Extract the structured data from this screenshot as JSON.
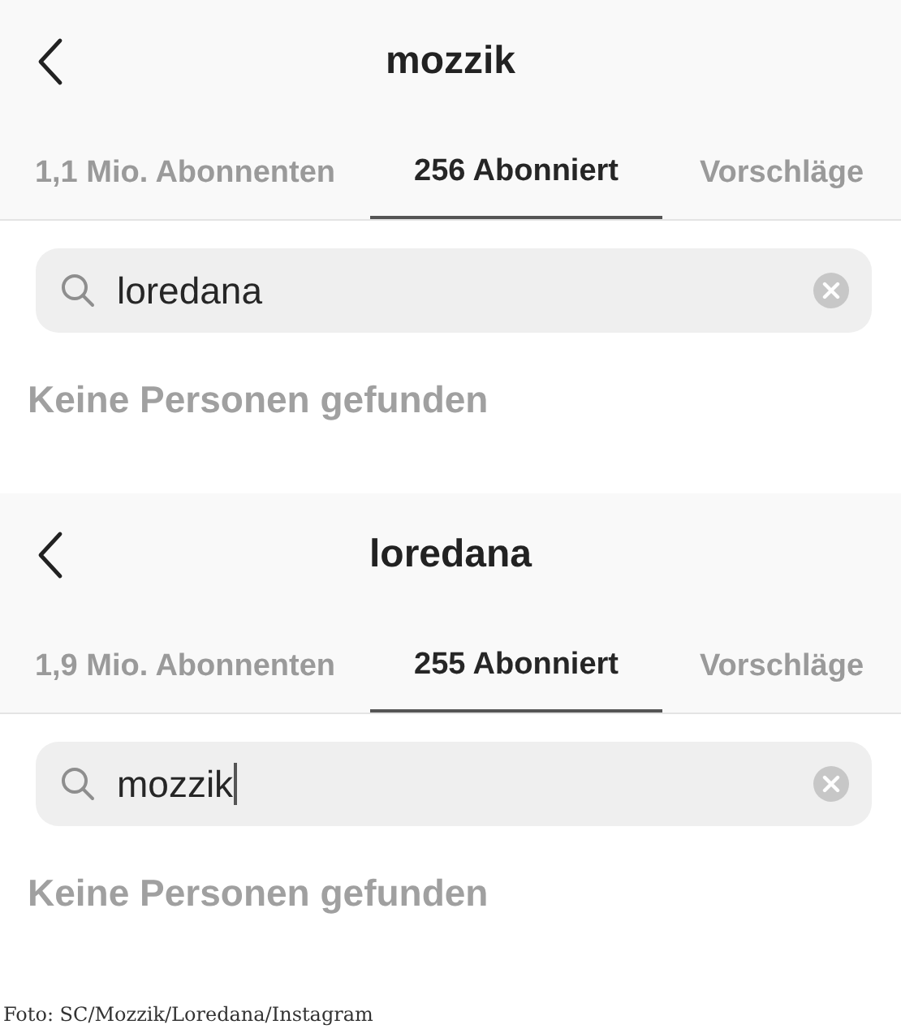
{
  "screens": [
    {
      "title": "mozzik",
      "tabs": [
        {
          "label": "1,1 Mio. Abonnenten",
          "selected": false
        },
        {
          "label": "256 Abonniert",
          "selected": true
        },
        {
          "label": "Vorschläge",
          "selected": false
        }
      ],
      "search": {
        "value": "loredana",
        "focused": false
      },
      "message": "Keine Personen gefunden"
    },
    {
      "title": "loredana",
      "tabs": [
        {
          "label": "1,9 Mio. Abonnenten",
          "selected": false
        },
        {
          "label": "255 Abonniert",
          "selected": true
        },
        {
          "label": "Vorschläge",
          "selected": false
        }
      ],
      "search": {
        "value": "mozzik",
        "focused": true
      },
      "message": "Keine Personen gefunden"
    }
  ],
  "caption": "Foto: SC/Mozzik/Loredana/Instagram"
}
